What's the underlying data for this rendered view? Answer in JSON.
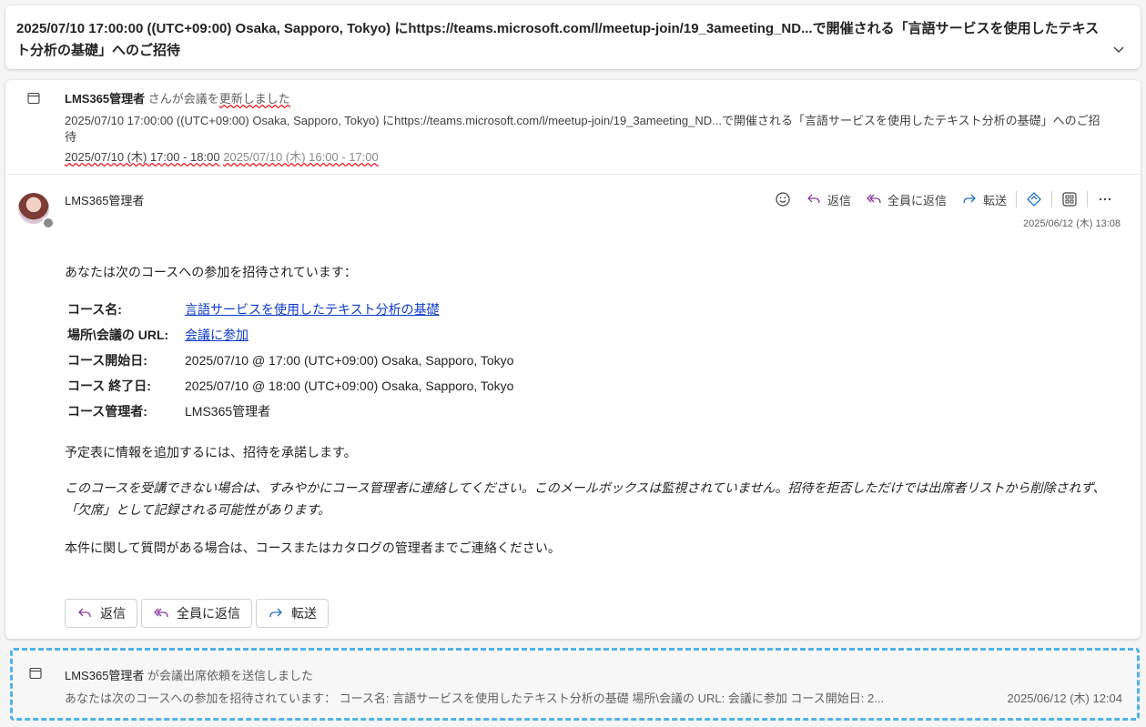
{
  "subject": "2025/07/10 17:00:00 ((UTC+09:00) Osaka, Sapporo, Tokyo) にhttps://teams.microsoft.com/l/meetup-join/19_3ameeting_ND...で開催される「言語サービスを使用したテキスト分析の基礎」へのご招待",
  "update": {
    "actor": "LMS365管理者",
    "action_prefix": " さんが会議を",
    "action_highlight": "更新しました",
    "detail": "2025/07/10 17:00:00 ((UTC+09:00) Osaka, Sapporo, Tokyo) にhttps://teams.microsoft.com/l/meetup-join/19_3ameeting_ND...で開催される「言語サービスを使用したテキスト分析の基礎」へのご招待",
    "new_time": "2025/07/10 (木) 17:00 - 18:00",
    "old_time": "2025/07/10 (木) 16:00 - 17:00"
  },
  "message": {
    "sender": "LMS365管理者",
    "date": "2025/06/12 (木) 13:08",
    "toolbar": {
      "reply": "返信",
      "reply_all": "全員に返信",
      "forward": "転送"
    },
    "intro": "あなたは次のコースへの参加を招待されています：",
    "rows": [
      {
        "label": "コース名:",
        "value": "言語サービスを使用したテキスト分析の基礎"
      },
      {
        "label": "場所\\会議の URL:",
        "value": "会議に参加"
      },
      {
        "label": "コース開始日:",
        "value": "2025/07/10 @ 17:00 (UTC+09:00) Osaka, Sapporo, Tokyo"
      },
      {
        "label": "コース 終了日:",
        "value": "2025/07/10 @ 18:00 (UTC+09:00) Osaka, Sapporo, Tokyo"
      },
      {
        "label": "コース管理者:",
        "value": "LMS365管理者"
      }
    ],
    "accept": "予定表に情報を追加するには、招待を承諾します。",
    "notice": "このコースを受講できない場合は、すみやかにコース管理者に連絡してください。このメールボックスは監視されていません。招待を拒否しただけでは出席者リストから削除されず、「欠席」として記録される可能性があります。",
    "contact": "本件に関して質問がある場合は、コースまたはカタログの管理者までご連絡ください。",
    "actions": {
      "reply": "返信",
      "reply_all": "全員に返信",
      "forward": "転送"
    }
  },
  "collapsed": {
    "actor": "LMS365管理者",
    "action": " が会議出席依頼を送信しました",
    "preview": "あなたは次のコースへの参加を招待されています： コース名: 言語サービスを使用したテキスト分析の基礎 場所\\会議の URL: 会議に参加 コース開始日: 2...",
    "date": "2025/06/12 (木) 12:04"
  },
  "icons": {
    "calendar": "calendar-icon",
    "chevron": "chevron-down-icon",
    "emoji": "emoji-icon",
    "reply": "reply-icon",
    "reply_all": "reply-all-icon",
    "forward": "forward-icon",
    "teams": "teams-icon",
    "apps": "apps-icon",
    "more": "more-icon"
  },
  "colors": {
    "link": "#0f3cc9",
    "reply_all_accent": "#8a3a9c",
    "forward_accent": "#1f6fc2",
    "selection": "#4fb3e8"
  }
}
